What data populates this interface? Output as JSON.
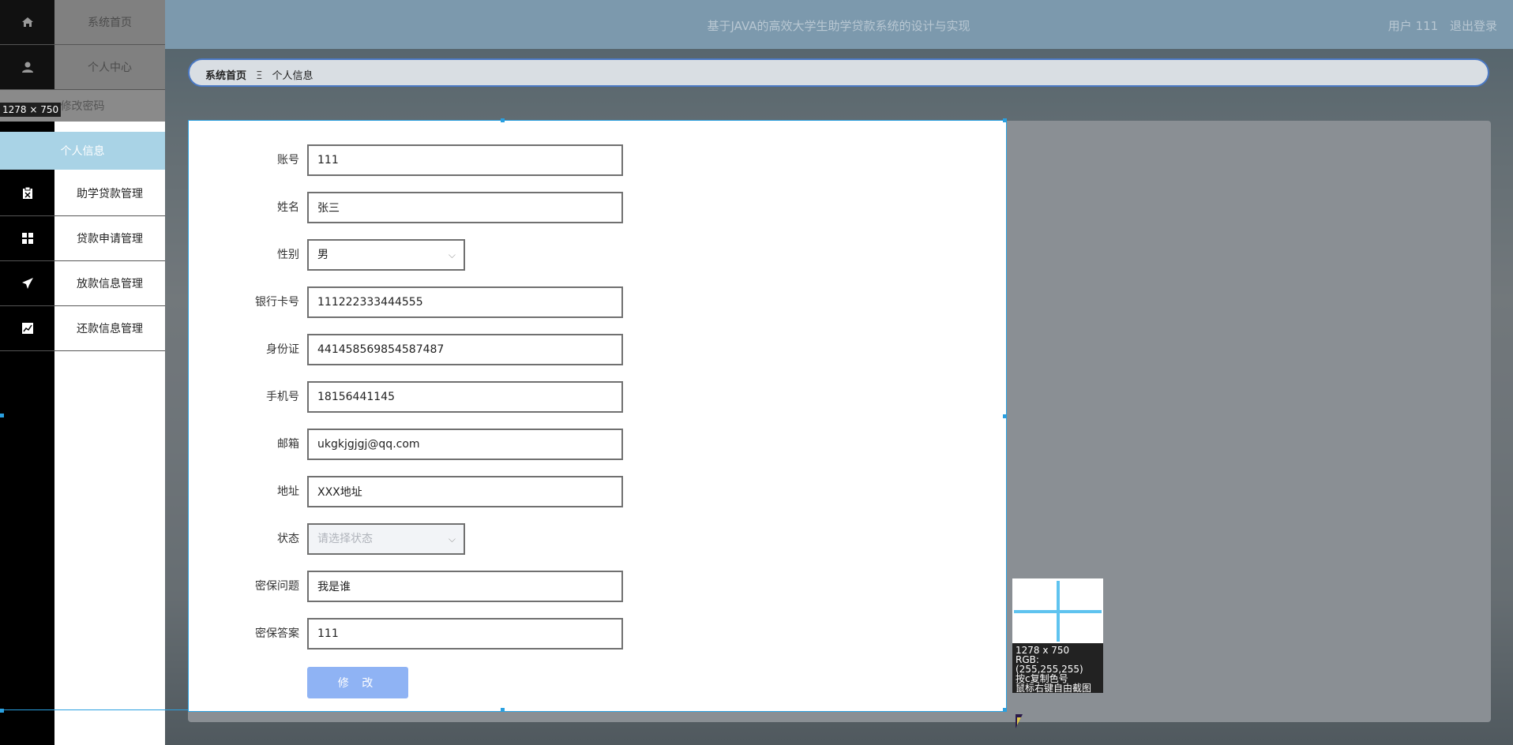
{
  "header": {
    "title": "基于JAVA的高效大学生助学贷款系统的设计与实现",
    "user_label": "用户 111",
    "logout_label": "退出登录"
  },
  "breadcrumb": {
    "home": "系统首页",
    "separator": "Ξ",
    "current": "个人信息"
  },
  "sidebar": {
    "items": [
      {
        "label": "系统首页",
        "icon": "home-icon"
      },
      {
        "label": "个人中心",
        "icon": "user-icon"
      },
      {
        "label": "修改密码",
        "icon": ""
      },
      {
        "label": "个人信息",
        "icon": ""
      },
      {
        "label": "助学贷款管理",
        "icon": "clipboard-icon"
      },
      {
        "label": "贷款申请管理",
        "icon": "grid-icon"
      },
      {
        "label": "放款信息管理",
        "icon": "send-icon"
      },
      {
        "label": "还款信息管理",
        "icon": "chart-icon"
      }
    ],
    "size_badge": "1278 × 750"
  },
  "form": {
    "fields": [
      {
        "label": "账号",
        "value": "111"
      },
      {
        "label": "姓名",
        "value": "张三"
      },
      {
        "label": "性别",
        "value": "男"
      },
      {
        "label": "银行卡号",
        "value": "111222333444555"
      },
      {
        "label": "身份证",
        "value": "441458569854587487"
      },
      {
        "label": "手机号",
        "value": "18156441145"
      },
      {
        "label": "邮箱",
        "value": "ukgkjgjgj@qq.com"
      },
      {
        "label": "地址",
        "value": "XXX地址"
      },
      {
        "label": "状态",
        "placeholder": "请选择状态"
      },
      {
        "label": "密保问题",
        "value": "我是谁"
      },
      {
        "label": "密保答案",
        "value": "111"
      }
    ],
    "submit_label": "修 改"
  },
  "picker": {
    "size": "1278 x 750",
    "rgb": "RGB:(255,255,255)",
    "hint1": "按c复制色号",
    "hint2": "鼠标右键自由截图"
  },
  "colors": {
    "accent_blue": "#2aa0e0",
    "active_menu": "#a9d3e6",
    "button": "#8fb3f4"
  }
}
